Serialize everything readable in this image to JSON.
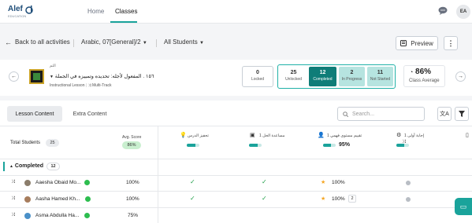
{
  "brand": {
    "name": "Alef",
    "sub": "EDUCATION"
  },
  "topnav": {
    "tabs": [
      "Home",
      "Classes"
    ],
    "active": "Classes",
    "user_initials": "EA"
  },
  "subheader": {
    "back_label": "Back to all activities",
    "class_selector": "Arabic, 07[General]/2",
    "students_selector": "All Students",
    "preview_label": "Preview"
  },
  "lesson": {
    "category": "التم",
    "title": "١٥٦ . المفعول لأجله: تحديده وتمييزه في الجملة",
    "type_label": "Instructional Lesson",
    "track_label": "Multi-Track"
  },
  "stats": {
    "locked": {
      "value": "0",
      "label": "Locked"
    },
    "unlocked": {
      "value": "25",
      "label": "Unlocked"
    },
    "completed": {
      "value": "12",
      "label": "Completed"
    },
    "in_progress": {
      "value": "2",
      "label": "In Progress"
    },
    "not_started": {
      "value": "11",
      "label": "Not Started"
    },
    "class_average": {
      "value": "86%",
      "label": "Class Average"
    }
  },
  "content_tabs": {
    "lesson_content": "Lesson Content",
    "extra_content": "Extra Content"
  },
  "search": {
    "placeholder": "Search..."
  },
  "table": {
    "total_students_label": "Total Students",
    "total_students": "25",
    "avg_score_label": "Avg. Score",
    "avg_score": "86%",
    "columns": [
      {
        "label": "تحفيز الدرس",
        "progress": 0.7
      },
      {
        "label": "مساعدة الحل 1",
        "progress": 0.7
      },
      {
        "label": "تقييم مستوى فهمي 1",
        "progress": 0.6,
        "score": "95%"
      },
      {
        "label": "إجابة أولى 1",
        "progress": 0.6
      }
    ],
    "group_label": "Completed",
    "group_count": "12",
    "rows": [
      {
        "name": "Aaesha Obaid Mo...",
        "score": "100%",
        "col3": "100%",
        "col3_badge": ""
      },
      {
        "name": "Aasha Hamed Kh...",
        "score": "100%",
        "col3": "100%",
        "col3_badge": "2"
      },
      {
        "name": "Asma Abdulla Ha...",
        "score": "75%",
        "col3": "",
        "col3_badge": ""
      }
    ]
  },
  "colors": {
    "accent": "#1aa39b",
    "check": "#22a04b",
    "star": "#f5a623"
  }
}
